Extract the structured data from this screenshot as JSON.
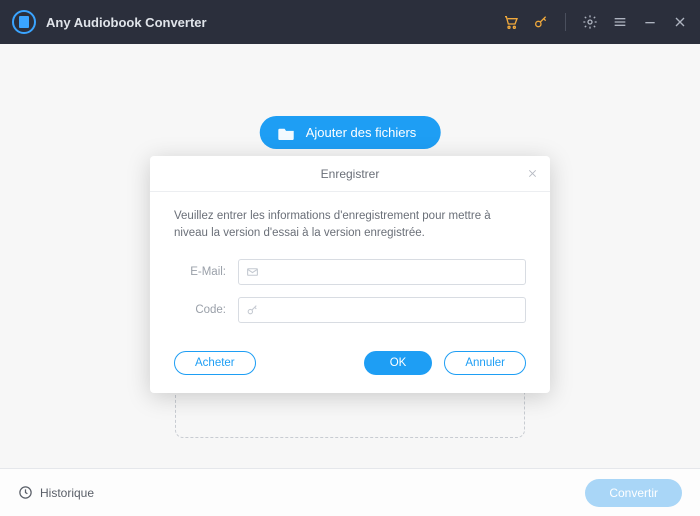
{
  "titlebar": {
    "app_name": "Any Audiobook Converter"
  },
  "main": {
    "add_button": "Ajouter des fichiers"
  },
  "footer": {
    "history": "Historique",
    "convert": "Convertir"
  },
  "modal": {
    "title": "Enregistrer",
    "instruction": "Veuillez entrer les informations d'enregistrement pour mettre à niveau la version d'essai à la version enregistrée.",
    "email_label": "E-Mail:",
    "code_label": "Code:",
    "email_value": "",
    "code_value": "",
    "buy": "Acheter",
    "ok": "OK",
    "cancel": "Annuler"
  },
  "colors": {
    "accent": "#1e9ef4",
    "titlebar_bg": "#2b2f3c",
    "warn": "#f0a93c"
  }
}
